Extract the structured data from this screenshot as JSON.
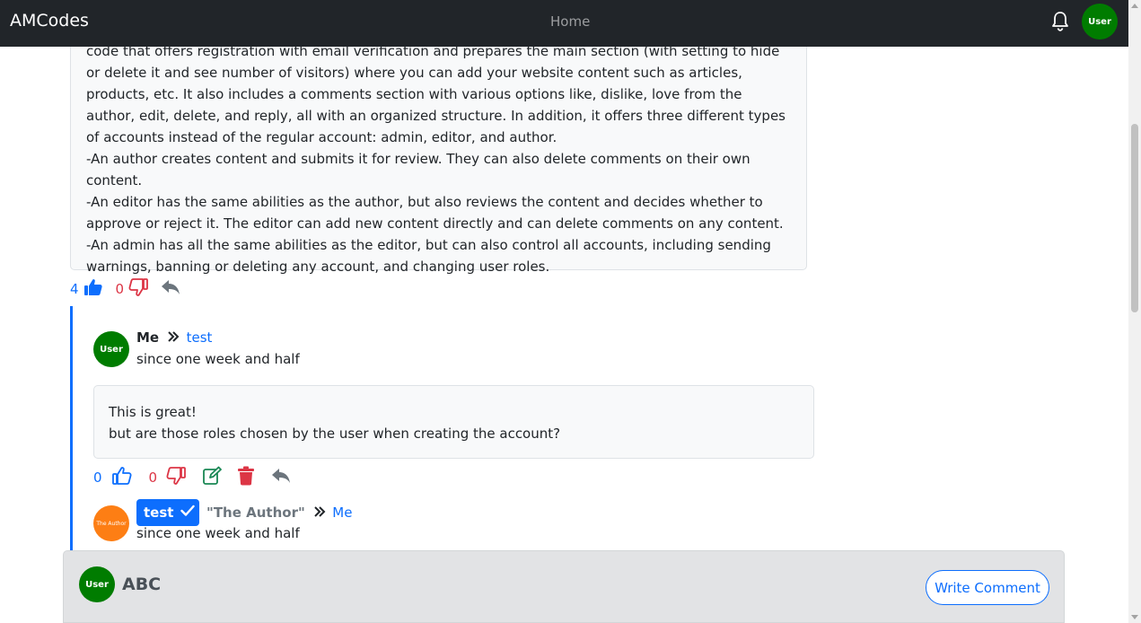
{
  "navbar": {
    "brand": "AMCodes",
    "home_label": "Home",
    "user_avatar_label": "User"
  },
  "post": {
    "paragraphs": [
      "code that offers registration with email verification and prepares the main section (with setting to hide or delete it and see number of visitors) where you can add your website content such as articles, products, etc. It also includes a comments section with various options like, dislike, love from the author, edit, delete, and reply, all with an organized structure. In addition, it offers three different types of accounts instead of the regular account: admin, editor, and author.",
      "-An author creates content and submits it for review. They can also delete comments on their own content.",
      "-An editor has the same abilities as the author, but also reviews the content and decides whether to approve or reject it. The editor can add new content directly and can delete comments on any content.",
      "-An admin has all the same abilities as the editor, but can also control all accounts, including sending warnings, banning or deleting any account, and changing user roles."
    ],
    "likes": "4",
    "dislikes": "0"
  },
  "reply1": {
    "avatar_label": "User",
    "author": "Me",
    "reply_to": "test",
    "time": "since one week and half",
    "lines": [
      "This is great!",
      "but are those roles chosen by the user when creating the account?"
    ],
    "likes": "0",
    "dislikes": "0"
  },
  "reply2": {
    "avatar_label": "The Author",
    "author": "test",
    "role": "\"The Author\"",
    "reply_to": "Me",
    "time": "since one week and half"
  },
  "comment_bar": {
    "avatar_label": "User",
    "name": "ABC",
    "button_label": "Write Comment"
  },
  "colors": {
    "primary": "#0d6efd",
    "danger": "#dc3545",
    "success": "#198754",
    "user_avatar": "#007c00",
    "author_avatar": "#fd7e14",
    "navbar": "#212529"
  }
}
